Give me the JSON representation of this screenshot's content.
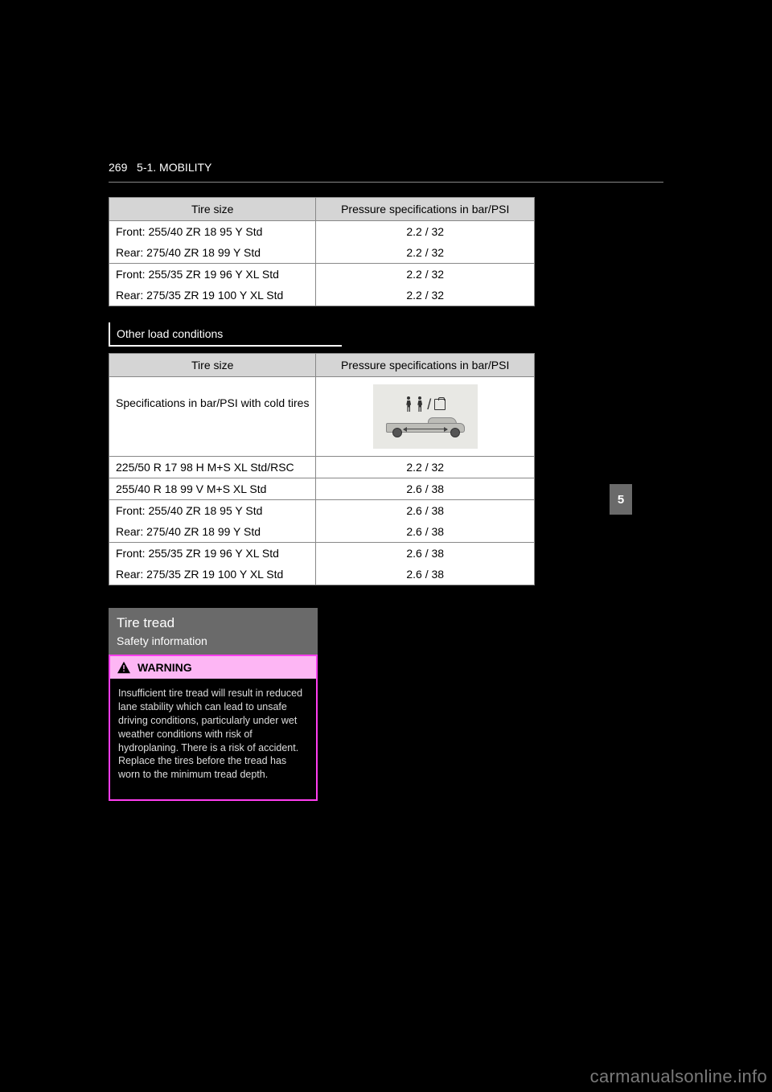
{
  "header": {
    "page_number": "269",
    "section": "5-1. MOBILITY"
  },
  "side_tab": "5",
  "watermark": "carmanualsonline.info",
  "table1": {
    "headers": [
      "Tire size",
      "Pressure specifications in bar/PSI"
    ],
    "groups": [
      [
        {
          "size": "Front: 255/40 ZR 18 95 Y Std",
          "psi": "2.2 / 32"
        },
        {
          "size": "Rear: 275/40 ZR 18 99 Y Std",
          "psi": "2.2 / 32"
        }
      ],
      [
        {
          "size": "Front: 255/35 ZR 19 96 Y XL Std",
          "psi": "2.2 / 32"
        },
        {
          "size": "Rear: 275/35 ZR 19 100 Y XL Std",
          "psi": "2.2 / 32"
        }
      ]
    ]
  },
  "heading2": "Other load conditions",
  "table2": {
    "headers": [
      "Tire size",
      "Pressure specifications in bar/PSI"
    ],
    "spec_row": {
      "label": "Specifications in bar/PSI with cold tires",
      "icon_name": "load-condition-icon"
    },
    "rows": [
      {
        "size": "225/50 R 17 98 H M+S XL Std/RSC",
        "psi": "2.2 / 32"
      },
      {
        "size": "255/40 R 18 99 V M+S XL Std",
        "psi": "2.6 / 38"
      }
    ],
    "groups": [
      [
        {
          "size": "Front: 255/40 ZR 18 95 Y Std",
          "psi": "2.6 / 38"
        },
        {
          "size": "Rear: 275/40 ZR 18 99 Y Std",
          "psi": "2.6 / 38"
        }
      ],
      [
        {
          "size": "Front: 255/35 ZR 19 96 Y XL Std",
          "psi": "2.6 / 38"
        },
        {
          "size": "Rear: 275/35 ZR 19 100 Y XL Std",
          "psi": "2.6 / 38"
        }
      ]
    ]
  },
  "tire_tread": {
    "title": "Tire tread",
    "subtitle": "Safety information",
    "warning_label": "WARNING",
    "warning_body": "Insufficient tire tread will result in reduced lane stability which can lead to unsafe driving conditions, particularly under wet weather conditions with risk of hydroplaning. There is a risk of accident. Replace the tires before the tread has worn to the minimum tread depth."
  }
}
